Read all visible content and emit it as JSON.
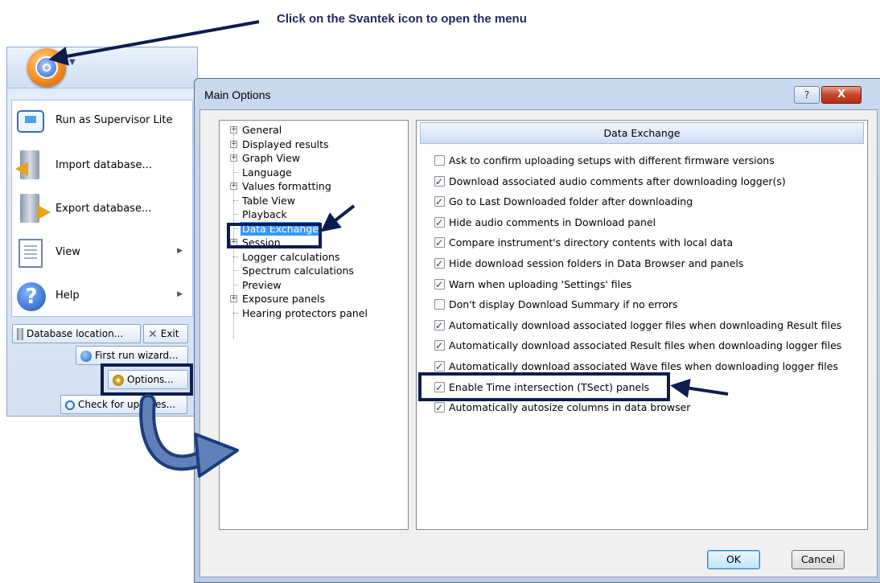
{
  "instruction": "Click on the Svantek icon to open the menu",
  "app_menu": {
    "items": [
      {
        "label": "Run as Supervisor Lite",
        "icon": "monitor-icon"
      },
      {
        "label": "Import database...",
        "icon": "import-database-icon"
      },
      {
        "label": "Export database...",
        "icon": "export-database-icon"
      },
      {
        "label": "View",
        "icon": "view-document-icon"
      },
      {
        "label": "Help",
        "icon": "help-icon"
      }
    ],
    "database_location": "Database location...",
    "exit": "Exit",
    "first_run_wizard": "First run wizard...",
    "options": "Options...",
    "check_updates": "Check for updates..."
  },
  "dialog": {
    "title": "Main Options",
    "help_glyph": "?",
    "close_glyph": "X",
    "tree": [
      {
        "label": "General",
        "expandable": true
      },
      {
        "label": "Displayed results",
        "expandable": true
      },
      {
        "label": "Graph View",
        "expandable": true
      },
      {
        "label": "Language",
        "expandable": false
      },
      {
        "label": "Values formatting",
        "expandable": true
      },
      {
        "label": "Table View",
        "expandable": false
      },
      {
        "label": "Playback",
        "expandable": false
      },
      {
        "label": "Data Exchange",
        "expandable": false,
        "selected": true
      },
      {
        "label": "Session",
        "expandable": true
      },
      {
        "label": "Logger calculations",
        "expandable": false
      },
      {
        "label": "Spectrum calculations",
        "expandable": false
      },
      {
        "label": "Preview",
        "expandable": false
      },
      {
        "label": "Exposure panels",
        "expandable": true
      },
      {
        "label": "Hearing protectors panel",
        "expandable": false
      }
    ],
    "panel_title": "Data Exchange",
    "options": [
      {
        "label": "Ask to confirm uploading setups with different firmware versions",
        "checked": false
      },
      {
        "label": "Download associated audio comments after downloading logger(s)",
        "checked": true
      },
      {
        "label": "Go to Last Downloaded folder after downloading",
        "checked": true
      },
      {
        "label": "Hide audio comments in Download panel",
        "checked": true
      },
      {
        "label": "Compare instrument's directory contents with local data",
        "checked": true
      },
      {
        "label": "Hide download session folders in Data Browser and panels",
        "checked": true
      },
      {
        "label": "Warn when uploading 'Settings' files",
        "checked": true
      },
      {
        "label": "Don't display Download Summary if no errors",
        "checked": false
      },
      {
        "label": "Automatically download associated logger files when downloading Result files",
        "checked": true
      },
      {
        "label": "Automatically download associated Result files when downloading logger files",
        "checked": true
      },
      {
        "label": "Automatically download associated Wave files when downloading logger files",
        "checked": true
      },
      {
        "label": "Enable Time intersection (TSect) panels",
        "checked": true
      },
      {
        "label": "Automatically autosize columns in data browser",
        "checked": true
      }
    ],
    "ok": "OK",
    "cancel": "Cancel"
  },
  "colors": {
    "highlight": "#0e1c4f",
    "selection": "#3399ff",
    "instruction_text": "#1f2a5c"
  }
}
